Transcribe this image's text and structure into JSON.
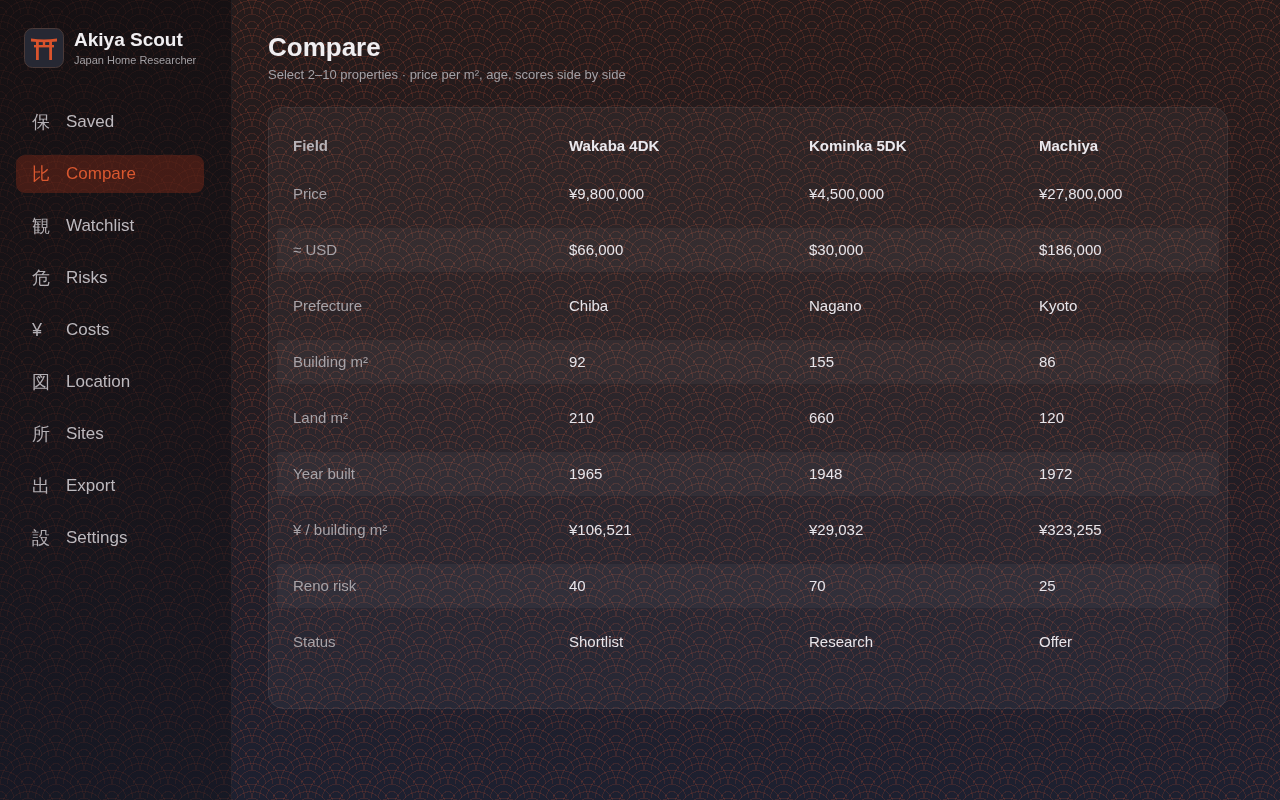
{
  "app": {
    "name": "Akiya Scout",
    "tagline": "Japan Home Researcher"
  },
  "nav": [
    {
      "glyph": "保",
      "label": "Saved",
      "selected": false
    },
    {
      "glyph": "比",
      "label": "Compare",
      "selected": true
    },
    {
      "glyph": "観",
      "label": "Watchlist",
      "selected": false
    },
    {
      "glyph": "危",
      "label": "Risks",
      "selected": false
    },
    {
      "glyph": "¥",
      "label": "Costs",
      "selected": false
    },
    {
      "glyph": "図",
      "label": "Location",
      "selected": false
    },
    {
      "glyph": "所",
      "label": "Sites",
      "selected": false
    },
    {
      "glyph": "出",
      "label": "Export",
      "selected": false
    },
    {
      "glyph": "設",
      "label": "Settings",
      "selected": false
    }
  ],
  "page": {
    "title": "Compare",
    "subtitle": "Select 2–10 properties · price per m², age, scores side by side"
  },
  "table": {
    "columns": [
      "Field",
      "Wakaba 4DK",
      "Kominka 5DK",
      "Machiya"
    ],
    "rows": [
      {
        "cells": [
          "Price",
          "¥9,800,000",
          "¥4,500,000",
          "¥27,800,000"
        ]
      },
      {
        "cells": [
          "≈ USD",
          "$66,000",
          "$30,000",
          "$186,000"
        ]
      },
      {
        "cells": [
          "Prefecture",
          "Chiba",
          "Nagano",
          "Kyoto"
        ]
      },
      {
        "cells": [
          "Building m²",
          "92",
          "155",
          "86"
        ]
      },
      {
        "cells": [
          "Land m²",
          "210",
          "660",
          "120"
        ]
      },
      {
        "cells": [
          "Year built",
          "1965",
          "1948",
          "1972"
        ]
      },
      {
        "cells": [
          "¥ / building m²",
          "¥106,521",
          "¥29,032",
          "¥323,255"
        ]
      },
      {
        "cells": [
          "Reno risk",
          "40",
          "70",
          "25"
        ]
      },
      {
        "cells": [
          "Status",
          "Shortlist",
          "Research",
          "Offer"
        ]
      }
    ]
  }
}
